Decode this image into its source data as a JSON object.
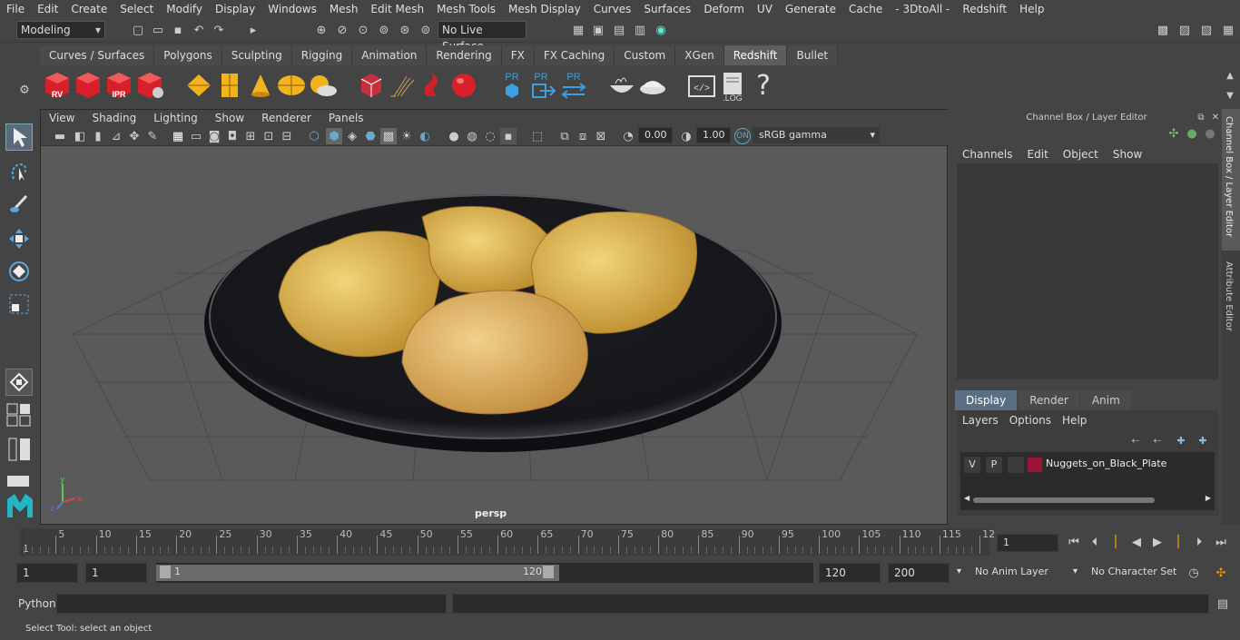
{
  "menubar": [
    "File",
    "Edit",
    "Create",
    "Select",
    "Modify",
    "Display",
    "Windows",
    "Mesh",
    "Edit Mesh",
    "Mesh Tools",
    "Mesh Display",
    "Curves",
    "Surfaces",
    "Deform",
    "UV",
    "Generate",
    "Cache",
    "- 3DtoAll -",
    "Redshift",
    "Help"
  ],
  "status": {
    "workspace": "Modeling",
    "live_surface": "No Live Surface"
  },
  "shelf_tabs": [
    "Curves / Surfaces",
    "Polygons",
    "Sculpting",
    "Rigging",
    "Animation",
    "Rendering",
    "FX",
    "FX Caching",
    "Custom",
    "XGen",
    "Redshift",
    "Bullet"
  ],
  "shelf_active": "Redshift",
  "shelf_icon_labels": {
    "rv": "RV",
    "ipr": "IPR",
    "pr": "PR",
    "log": ".LOG",
    "help": "?"
  },
  "viewport": {
    "menu": [
      "View",
      "Shading",
      "Lighting",
      "Show",
      "Renderer",
      "Panels"
    ],
    "exposure": "0.00",
    "gamma": "1.00",
    "colorspace": "sRGB gamma",
    "camera": "persp",
    "axes": {
      "x": "x",
      "y": "y",
      "z": "z"
    }
  },
  "right_panel": {
    "title": "Channel Box / Layer Editor",
    "menu": [
      "Channels",
      "Edit",
      "Object",
      "Show"
    ],
    "tabs": [
      "Display",
      "Render",
      "Anim"
    ],
    "active_tab": "Display",
    "layer_menu": [
      "Layers",
      "Options",
      "Help"
    ],
    "layer": {
      "v": "V",
      "p": "P",
      "name": "Nuggets_on_Black_Plate",
      "color": "#9b1535"
    },
    "side_tabs": [
      "Channel Box / Layer Editor",
      "Attribute Editor"
    ]
  },
  "timeline": {
    "ticks": [
      "5",
      "10",
      "15",
      "20",
      "25",
      "30",
      "35",
      "40",
      "45",
      "50",
      "55",
      "60",
      "65",
      "70",
      "75",
      "80",
      "85",
      "90",
      "95",
      "100",
      "105",
      "110",
      "115",
      "12"
    ],
    "start_label": "1",
    "current": "1"
  },
  "range": {
    "start": "1",
    "start2": "1",
    "slider_start": "1",
    "slider_end": "120",
    "end": "120",
    "end2": "200",
    "anim_layer": "No Anim Layer",
    "char_set": "No Character Set"
  },
  "cmd": {
    "label": "Python"
  },
  "help_line": "Select Tool: select an object"
}
